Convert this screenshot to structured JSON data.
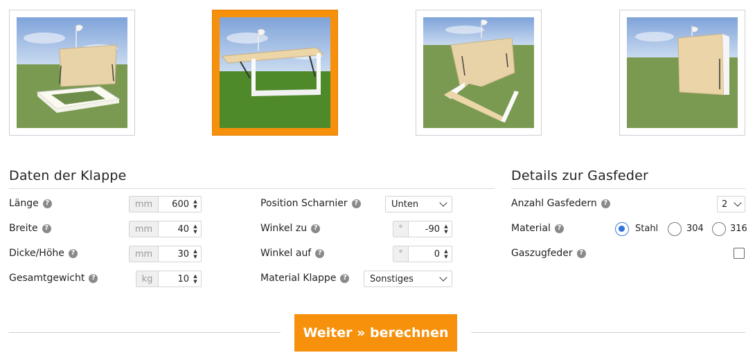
{
  "thumbnails": [
    {
      "name": "Unten angeschlagen, offen",
      "active": false
    },
    {
      "name": "Oben angeschlagen, offen",
      "active": true
    },
    {
      "name": "Seitlich angeschlagen",
      "active": false
    },
    {
      "name": "Senkrecht",
      "active": false
    }
  ],
  "flap": {
    "title": "Daten der Klappe",
    "length": {
      "label": "Länge",
      "unit": "mm",
      "value": "600"
    },
    "width": {
      "label": "Breite",
      "unit": "mm",
      "value": "40"
    },
    "thickness": {
      "label": "Dicke/Höhe",
      "unit": "mm",
      "value": "30"
    },
    "weight": {
      "label": "Gesamtgewicht",
      "unit": "kg",
      "value": "10"
    },
    "hinge_position": {
      "label": "Position Scharnier",
      "value": "Unten"
    },
    "angle_closed": {
      "label": "Winkel zu",
      "unit": "°",
      "value": "-90"
    },
    "angle_open": {
      "label": "Winkel auf",
      "unit": "°",
      "value": "0"
    },
    "material": {
      "label": "Material Klappe",
      "value": "Sonstiges"
    }
  },
  "gas": {
    "title": "Details zur Gasfeder",
    "count": {
      "label": "Anzahl Gasfedern",
      "value": "2"
    },
    "material": {
      "label": "Material",
      "options": [
        "Stahl",
        "304",
        "316"
      ],
      "selected": "Stahl"
    },
    "tension": {
      "label": "Gaszugfeder",
      "checked": false
    }
  },
  "help_glyph": "?",
  "submit_label": "Weiter » berechnen",
  "colors": {
    "accent": "#f7900a",
    "radio": "#2f72d9"
  }
}
